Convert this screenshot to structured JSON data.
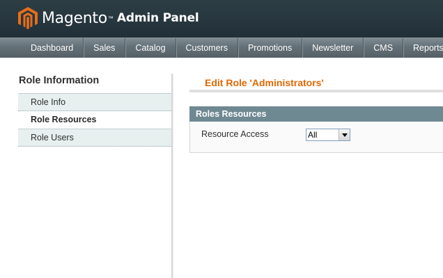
{
  "header": {
    "brand": "Magento",
    "trademark": "™",
    "suffix": "Admin Panel",
    "logo_icon": "magento-logo-icon",
    "colors": {
      "header_bg": "#24343b",
      "logo_orange": "#e96e1a",
      "nav_bg": "#647077"
    }
  },
  "nav": {
    "items": [
      {
        "label": "Dashboard"
      },
      {
        "label": "Sales"
      },
      {
        "label": "Catalog"
      },
      {
        "label": "Customers"
      },
      {
        "label": "Promotions"
      },
      {
        "label": "Newsletter"
      },
      {
        "label": "CMS"
      },
      {
        "label": "Reports"
      }
    ]
  },
  "sidebar": {
    "title": "Role Information",
    "tabs": [
      {
        "label": "Role Info",
        "active": false
      },
      {
        "label": "Role Resources",
        "active": true
      },
      {
        "label": "Role Users",
        "active": false
      }
    ]
  },
  "main": {
    "page_title": "Edit Role 'Administrators'",
    "fieldset": {
      "legend": "Roles Resources",
      "resource_access": {
        "label": "Resource Access",
        "selected": "All",
        "arrow_icon": "dropdown-arrow-icon"
      }
    },
    "colors": {
      "title": "#e26703",
      "fieldset_head": "#6f8992"
    }
  }
}
